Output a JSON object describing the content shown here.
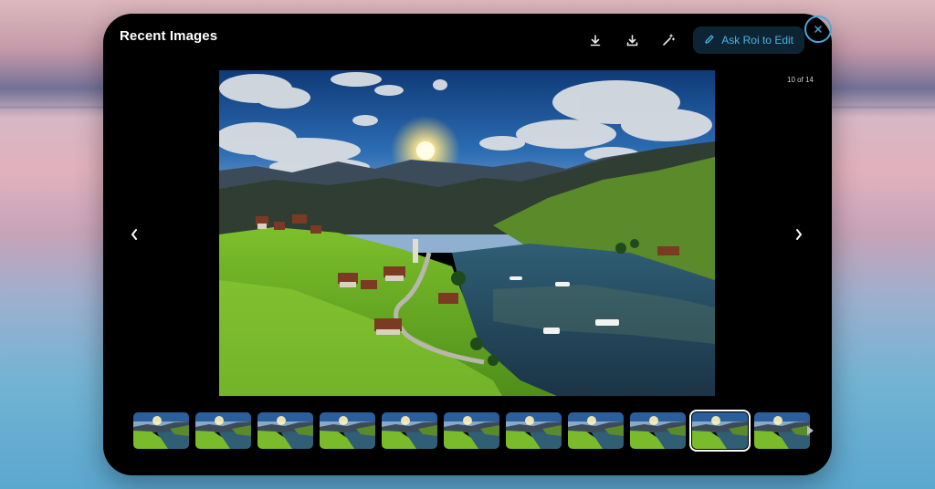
{
  "header": {
    "title": "Recent Images",
    "ask_button_label": "Ask Roi to Edit"
  },
  "viewer": {
    "counter": "10 of 14"
  },
  "icons": {
    "download_alt": "arrow-down-circle-icon",
    "download": "download-icon",
    "magic": "magic-wand-icon",
    "edit": "pencil-icon",
    "close": "close-icon",
    "prev": "chevron-left-icon",
    "next": "chevron-right-icon",
    "thumb_next": "triangle-right-icon"
  },
  "thumbnails": {
    "count": 11,
    "selected_index": 9
  },
  "colors": {
    "accent": "#4bb4e6",
    "panel": "#000000"
  }
}
